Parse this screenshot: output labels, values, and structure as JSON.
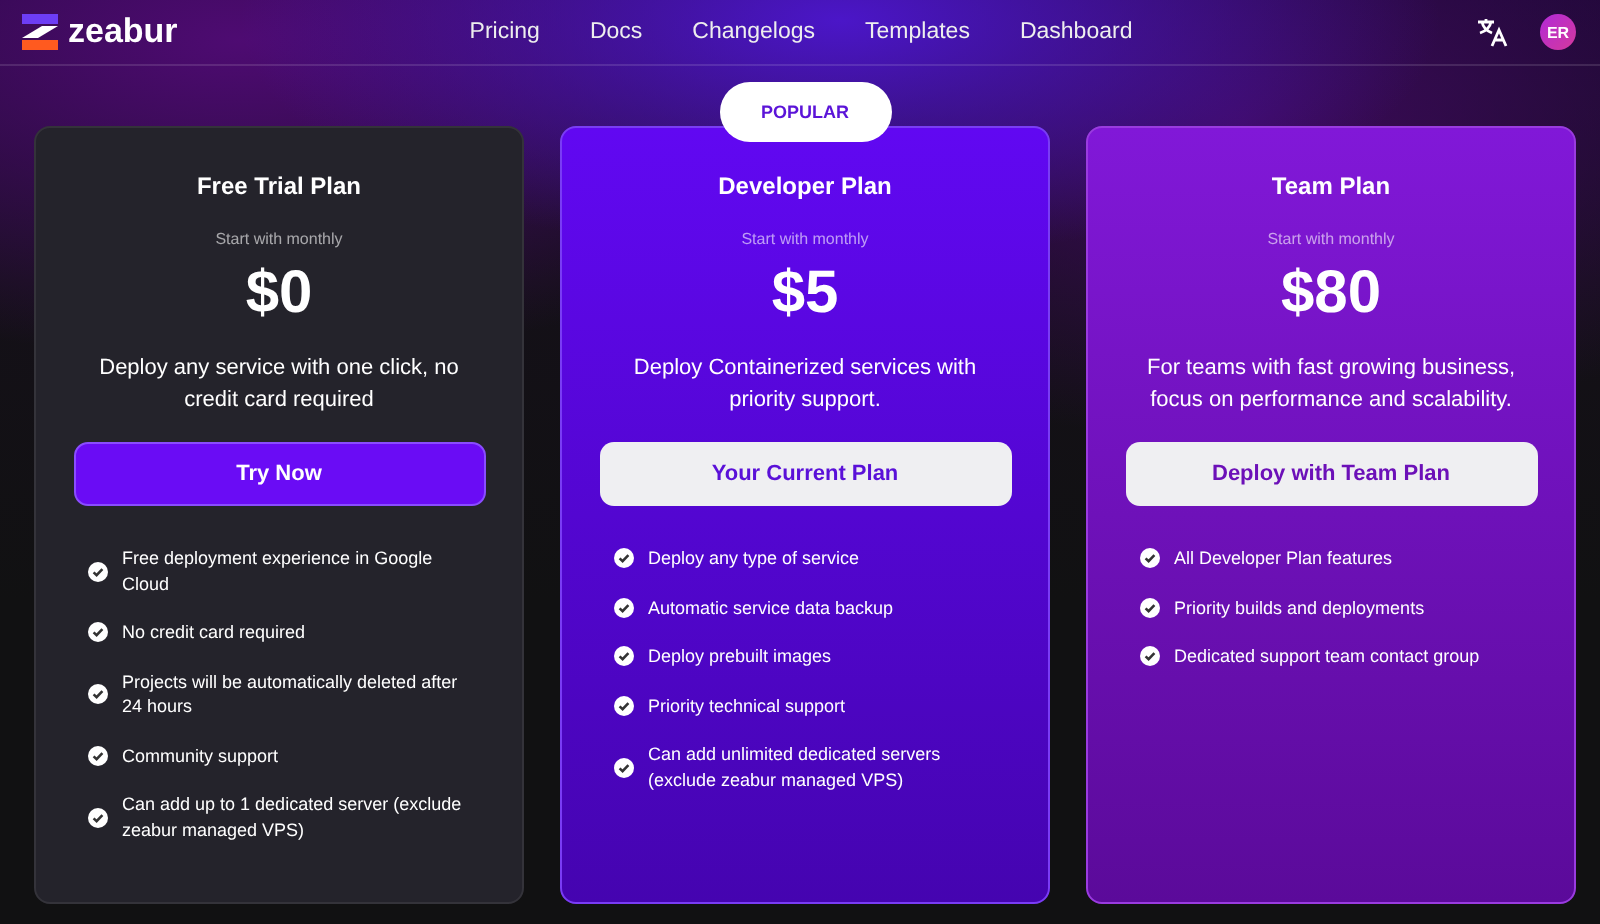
{
  "header": {
    "brand": "zeabur",
    "nav": [
      {
        "label": "Pricing"
      },
      {
        "label": "Docs"
      },
      {
        "label": "Changelogs"
      },
      {
        "label": "Templates"
      },
      {
        "label": "Dashboard"
      }
    ],
    "avatar": "ER"
  },
  "plans": [
    {
      "kind": "free",
      "title": "Free Trial Plan",
      "subtitle": "Start with monthly",
      "price": "$0",
      "description": "Deploy any service with one click, no credit card required",
      "button": "Try Now",
      "features": [
        "Free deployment experience in Google Cloud",
        "No credit card required",
        "Projects will be automatically deleted after 24 hours",
        "Community support",
        "Can add up to 1 dedicated server (exclude zeabur managed VPS)"
      ]
    },
    {
      "kind": "developer",
      "badge": "POPULAR",
      "title": "Developer Plan",
      "subtitle": "Start with monthly",
      "price": "$5",
      "description": "Deploy Containerized services with priority support.",
      "button": "Your Current Plan",
      "features": [
        "Deploy any type of service",
        "Automatic service data backup",
        "Deploy prebuilt images",
        "Priority technical support",
        "Can add unlimited dedicated servers (exclude zeabur managed VPS)"
      ]
    },
    {
      "kind": "team",
      "title": "Team Plan",
      "subtitle": "Start with monthly",
      "price": "$80",
      "description": "For teams with fast growing business, focus on performance and scalability.",
      "button": "Deploy with Team Plan",
      "features": [
        "All Developer Plan features",
        "Priority builds and deployments",
        "Dedicated support team contact group"
      ]
    }
  ]
}
